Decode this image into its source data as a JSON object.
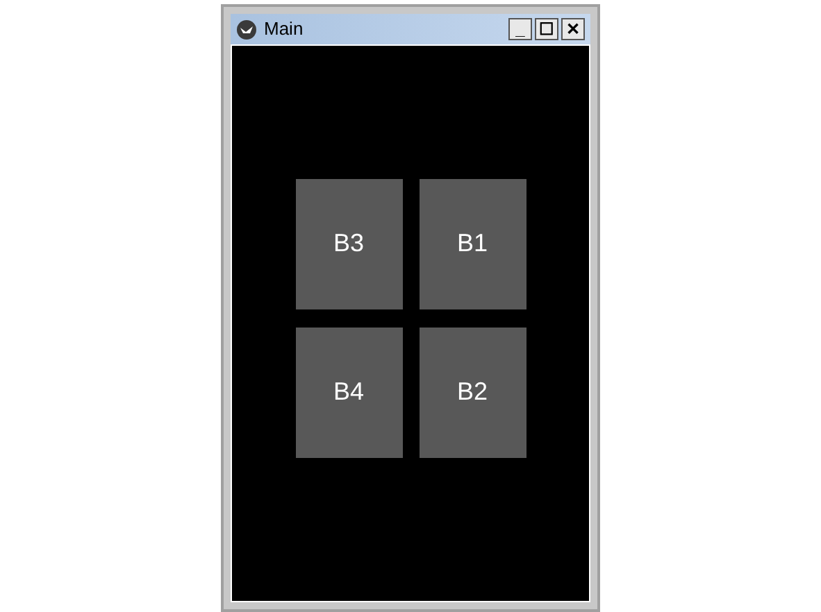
{
  "window": {
    "title": "Main",
    "controls": [
      "_",
      "☐",
      "✕"
    ]
  },
  "buttons": [
    {
      "label": "B3"
    },
    {
      "label": "B1"
    },
    {
      "label": "B4"
    },
    {
      "label": "B2"
    }
  ]
}
